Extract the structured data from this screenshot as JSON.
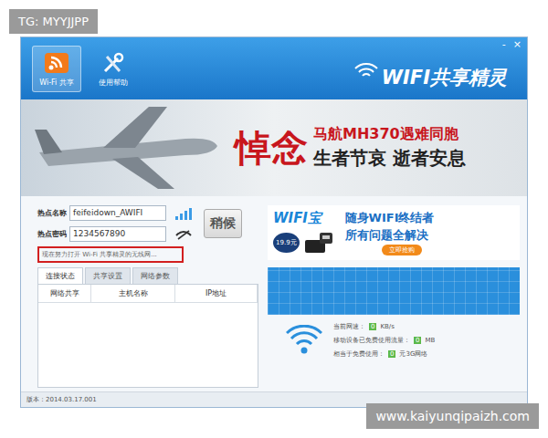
{
  "window": {
    "title": "WIFI共享精灵",
    "controls": [
      "-",
      "×"
    ]
  },
  "nav": [
    {
      "label": "Wi-Fi 共享",
      "selected": true
    },
    {
      "label": "使用帮助",
      "selected": false
    }
  ],
  "banner": {
    "headline": "悼念",
    "line1": "马航MH370遇难同胞",
    "line2": "生者节哀 逝者安息"
  },
  "hotspot": {
    "fields": [
      {
        "label": "热点名称",
        "value": "feifeidown_AWIFI",
        "kind": "signal"
      },
      {
        "label": "热点密码",
        "value": "1234567890",
        "kind": "password"
      }
    ],
    "action_button": {
      "label": "稍候",
      "disabled": true
    },
    "status": "现在努力打开 Wi-Fi 共享精灵的无线网..."
  },
  "tabs": [
    {
      "label": "连接状态",
      "selected": true
    },
    {
      "label": "共享设置",
      "selected": false
    },
    {
      "label": "网络参数",
      "selected": false
    }
  ],
  "table": {
    "columns": [
      "网络共享",
      "主机名称",
      "IP地址"
    ],
    "rows": []
  },
  "ad": {
    "brand": "WIFI宝",
    "price": "19.9元",
    "title": "随身WIFI终结者",
    "subtitle": "所有问题全解决",
    "button": "立即抢购"
  },
  "stats": [
    {
      "label": "当前网速：",
      "value": "0",
      "unit": "KB/s"
    },
    {
      "label": "移动设备已免费使用流量：",
      "value": "0",
      "unit": "MB"
    },
    {
      "label": "相当于免费使用：",
      "value": "0",
      "unit": "元3G网络"
    }
  ],
  "version": "版本：2014.03.17.001",
  "watermarks": [
    "TG: MYYJJPP",
    "www.kaiyunqipaizh.com"
  ]
}
